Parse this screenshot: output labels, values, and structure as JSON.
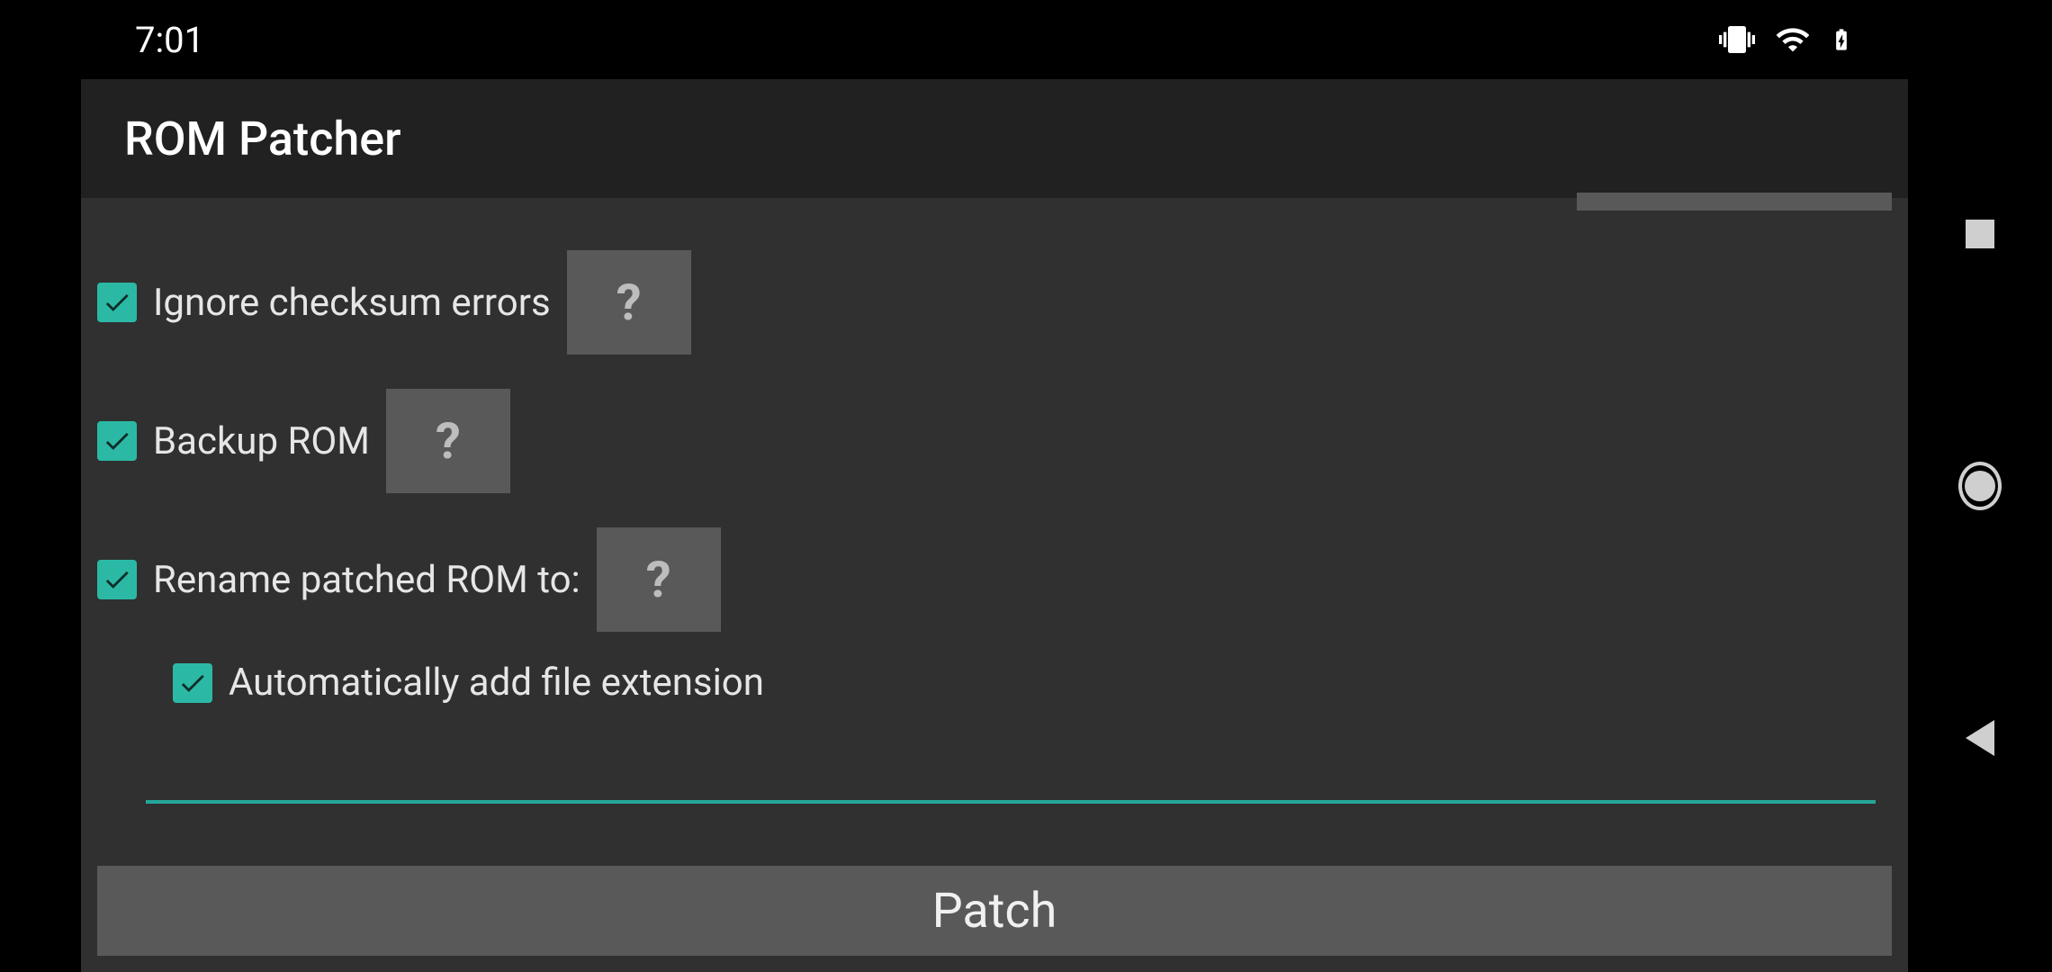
{
  "status": {
    "time": "7:01"
  },
  "app": {
    "title": "ROM Patcher"
  },
  "options": {
    "ignore_checksum": {
      "label": "Ignore checksum errors",
      "checked": true,
      "help": "?"
    },
    "backup_rom": {
      "label": "Backup ROM",
      "checked": true,
      "help": "?"
    },
    "rename_patched": {
      "label": "Rename patched ROM to:",
      "checked": true,
      "help": "?"
    },
    "auto_extension": {
      "label": "Automatically add file extension",
      "checked": true
    },
    "filename_value": ""
  },
  "actions": {
    "patch_label": "Patch"
  },
  "colors": {
    "accent": "#26a69a",
    "checkbox": "#2bb9a5",
    "surface": "#303030",
    "titlebar": "#212121",
    "button_raised": "#595959"
  }
}
